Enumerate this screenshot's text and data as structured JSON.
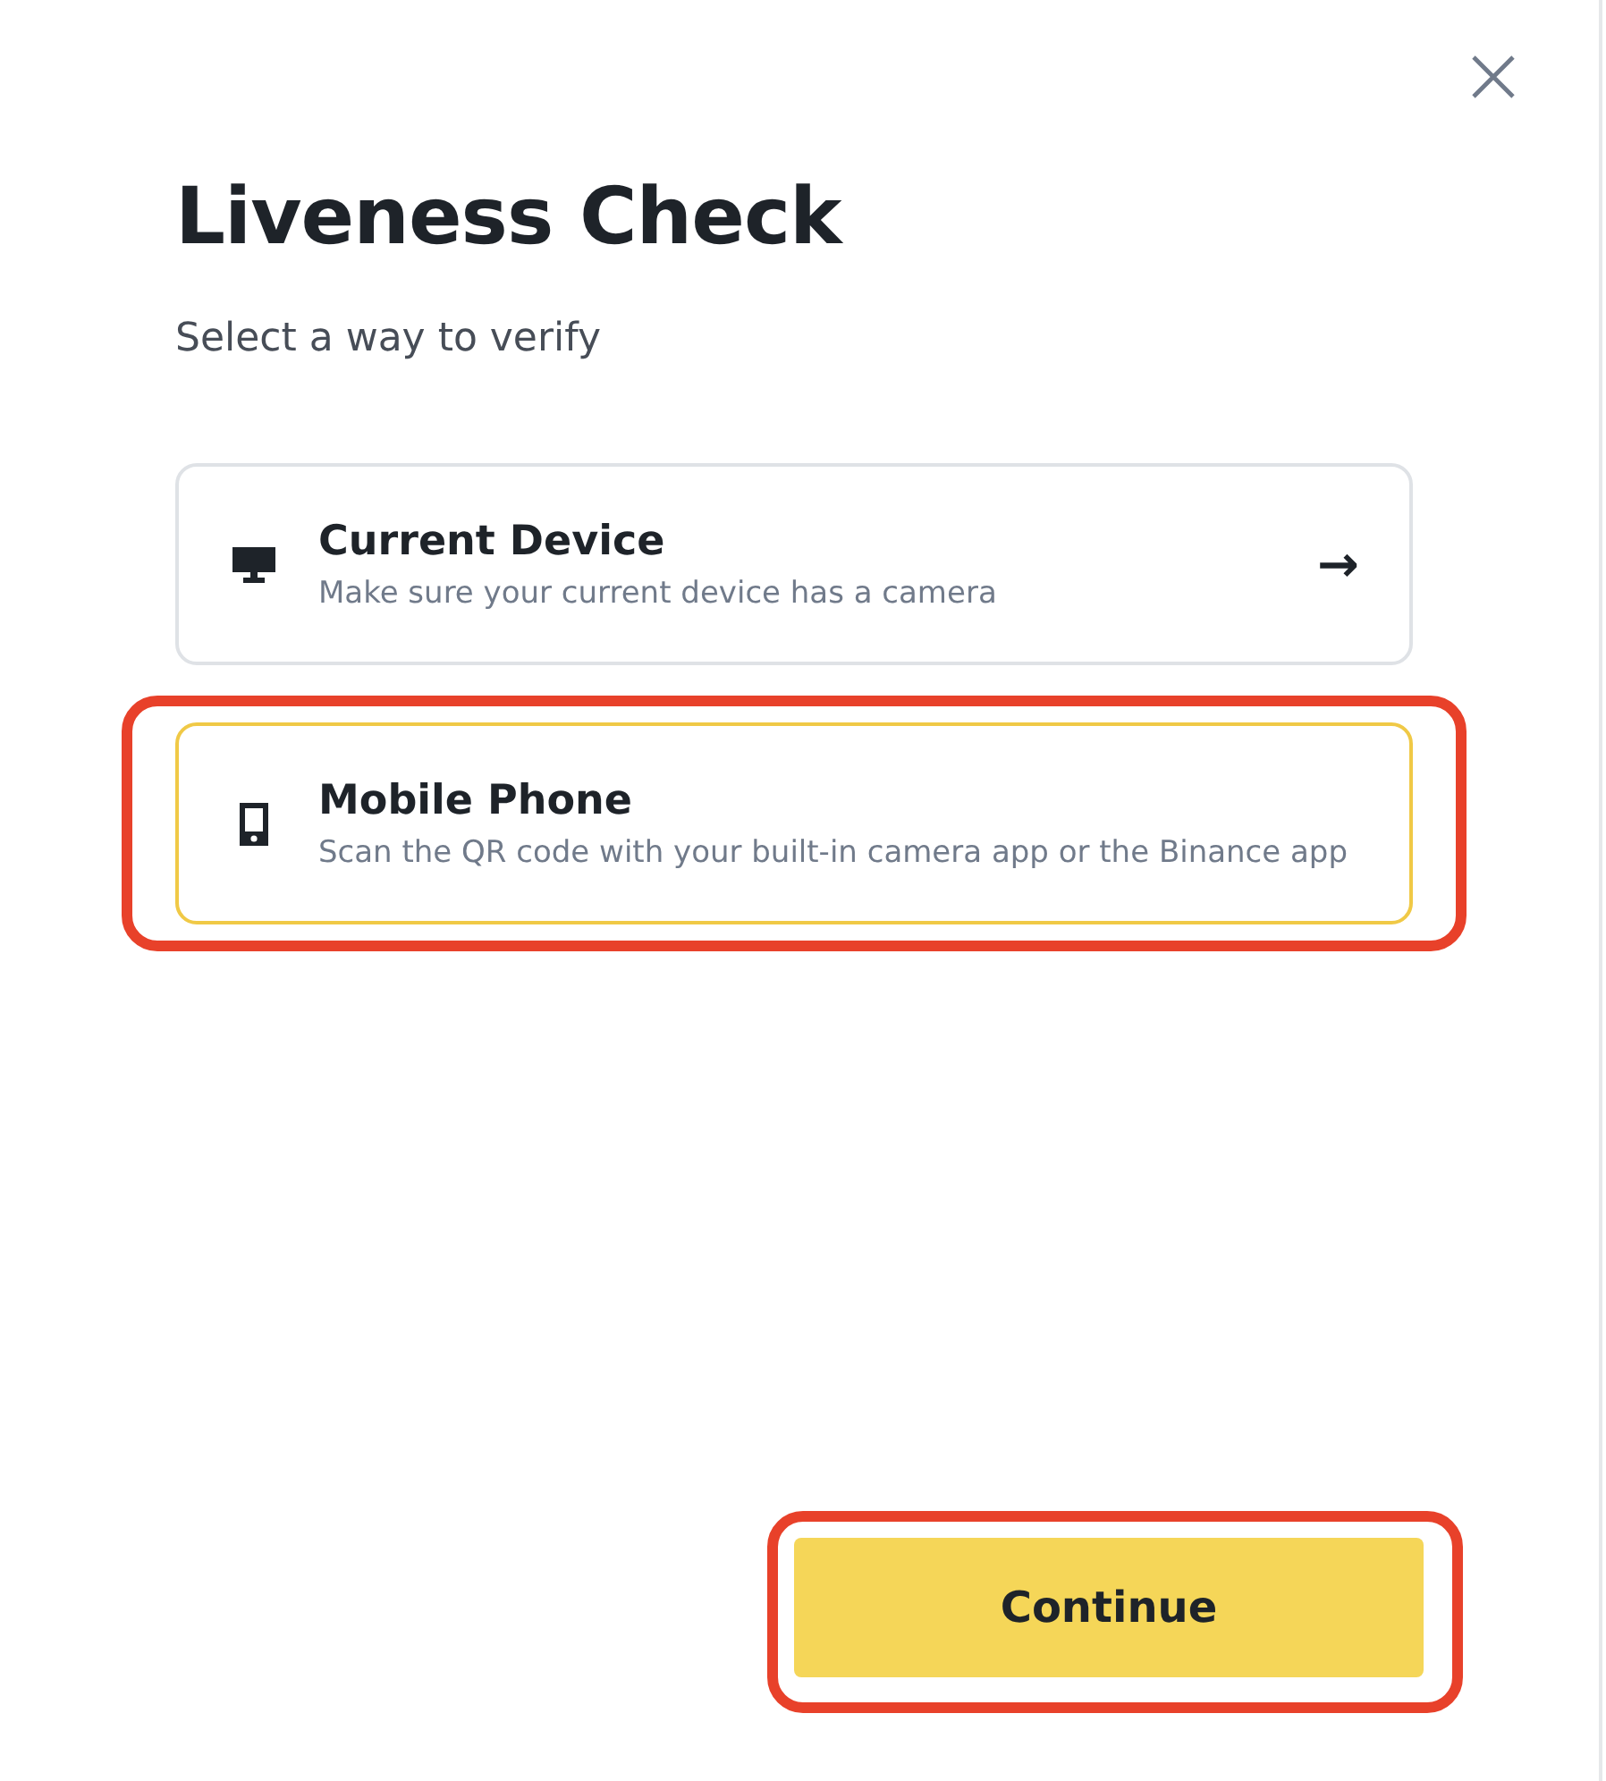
{
  "title": "Liveness Check",
  "subtitle": "Select a way to verify",
  "options": [
    {
      "kind": "desktop",
      "title": "Current Device",
      "description": "Make sure your current device has a camera",
      "selected": false,
      "highlighted": false,
      "arrow": "→"
    },
    {
      "kind": "phone",
      "title": "Mobile Phone",
      "description": "Scan the QR code with your built-in camera app or the Binance app",
      "selected": true,
      "highlighted": true
    }
  ],
  "continue_button": {
    "label": "Continue",
    "highlighted": true
  }
}
